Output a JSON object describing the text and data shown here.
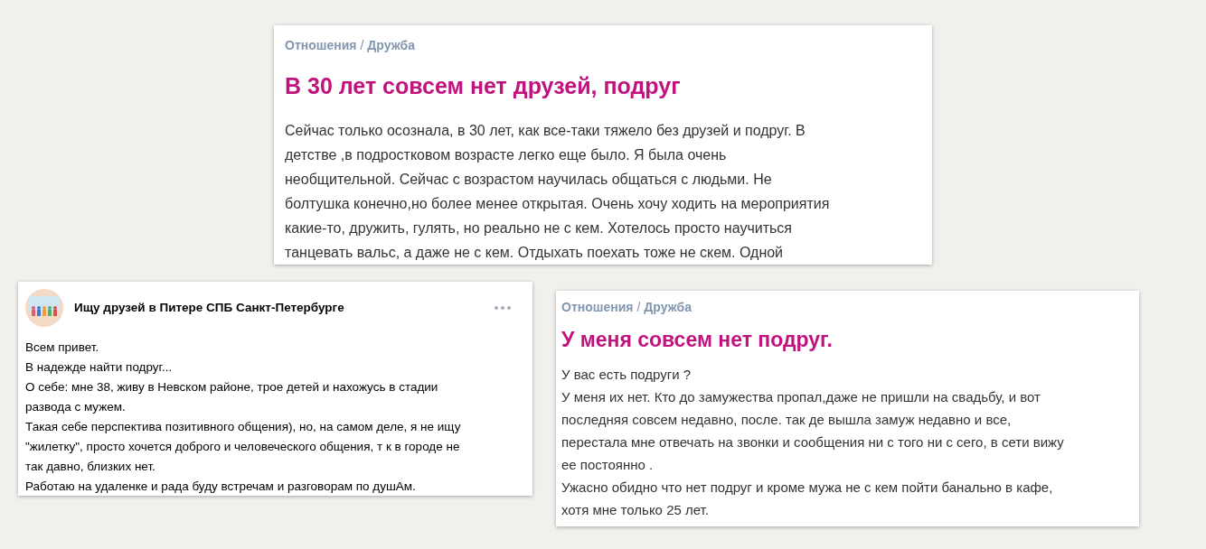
{
  "articles": [
    {
      "kind": "article",
      "breadcrumb": [
        "Отношения",
        "Дружба"
      ],
      "separator": "/",
      "title": "В 30 лет совсем нет друзей, подруг",
      "body": "Сейчас только осознала, в 30 лет, как все-таки тяжело без друзей и подруг. В\nдетстве ,в подростковом возрасте легко еще было. Я была очень\nнеобщительной. Сейчас с возрастом научилась общаться с людьми. Не\nболтушка конечно,но более менее открытая. Очень хочу ходить на мероприятия\nкакие-то, дружить, гулять, но реально не с кем. Хотелось просто научиться\nтанцевать вальс, а даже не с кем. Отдыхать поехать тоже не скем. Одной"
    },
    {
      "kind": "post",
      "group": "Ищу друзей в Питере СПБ Санкт-Петербурге",
      "body": "Всем привет.\nВ надежде найти подруг...\nО себе: мне 38, живу в Невском районе, трое детей и нахожусь в стадии\nразвода с мужем.\nТакая себе перспектива позитивного общения), но, на самом деле, я не ищу\n\"жилетку\", просто хочется доброго и человеческого общения, т к в городе не\nтак давно, близких нет.\nРаботаю на удаленке и рада буду встречам и разговорам по душАм."
    },
    {
      "kind": "article",
      "breadcrumb": [
        "Отношения",
        "Дружба"
      ],
      "separator": "/",
      "title": "У меня совсем нет подруг.",
      "body": "У вас есть подруги ?\nУ меня их нет. Кто до замужества пропал,даже не пришли на свадьбу, и вот\nпоследняя совсем недавно, после. так де вышла замуж недавно и все,\nперестала мне отвечать на звонки и сообщения ни с того ни с сего, в сети вижу\nее постоянно .\nУжасно обидно что нет подруг и кроме мужа не с кем пойти банально в кафе,\nхотя мне только 25 лет."
    }
  ]
}
